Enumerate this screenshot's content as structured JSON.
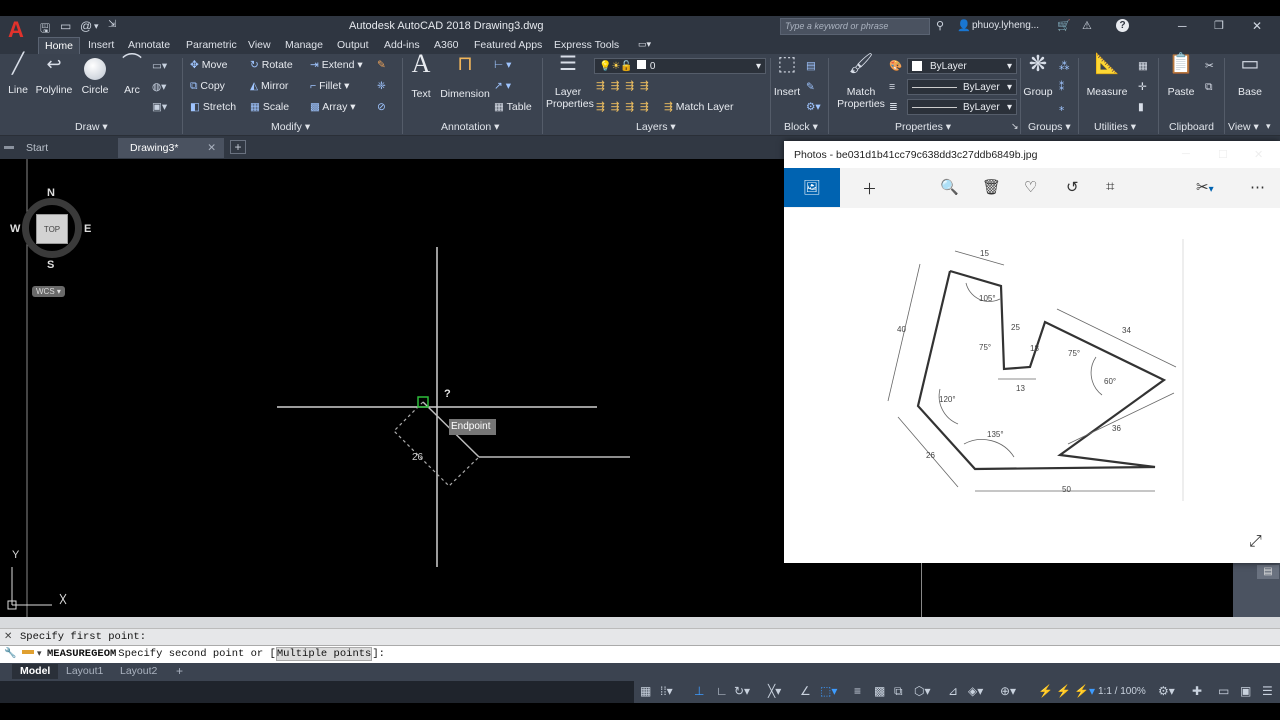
{
  "app": {
    "title": "Autodesk AutoCAD 2018    Drawing3.dwg",
    "logo": "A",
    "search_placeholder": "Type a keyword or phrase",
    "username": "phuoy.lyheng..."
  },
  "ribbon_tabs": [
    "Home",
    "Insert",
    "Annotate",
    "Parametric",
    "View",
    "Manage",
    "Output",
    "Add-ins",
    "A360",
    "Featured Apps",
    "Express Tools"
  ],
  "draw_panel": {
    "label": "Draw ▾",
    "line": "Line",
    "polyline": "Polyline",
    "circle": "Circle",
    "arc": "Arc"
  },
  "modify_panel": {
    "label": "Modify ▾",
    "move": "Move",
    "rotate": "Rotate",
    "extend": "Extend",
    "copy": "Copy",
    "mirror": "Mirror",
    "fillet": "Fillet",
    "stretch": "Stretch",
    "scale": "Scale",
    "array": "Array"
  },
  "annotation_panel": {
    "label": "Annotation ▾",
    "text": "Text",
    "dimension": "Dimension",
    "table": "Table"
  },
  "layers_panel": {
    "label": "Layers ▾",
    "layer_properties": "Layer\nProperties",
    "current_layer": "0",
    "match_layer": "Match Layer"
  },
  "block_panel": {
    "label": "Block ▾",
    "insert": "Insert"
  },
  "properties_panel": {
    "label": "Properties ▾",
    "match_properties": "Match\nProperties",
    "color": "ByLayer",
    "linetype": "ByLayer",
    "lineweight": "ByLayer"
  },
  "groups_panel": {
    "label": "Groups ▾",
    "group": "Group"
  },
  "utilities_panel": {
    "label": "Utilities ▾",
    "measure": "Measure"
  },
  "clipboard_panel": {
    "label": "Clipboard",
    "paste": "Paste"
  },
  "view_panel": {
    "label": "View ▾",
    "base": "Base"
  },
  "doc_tabs": [
    "Start",
    "Drawing3*"
  ],
  "viewcube": {
    "n": "N",
    "s": "S",
    "e": "E",
    "w": "W",
    "top": "TOP",
    "wcs": "WCS ▾"
  },
  "canvas": {
    "measure_value": "26",
    "cursor_mark": "?",
    "tooltip": "Endpoint",
    "ucs_y": "Y"
  },
  "photos": {
    "title": "Photos - be031d1b41cc79c638dd3c27ddb6849b.jpg",
    "dims": {
      "d15": "15",
      "d105": "105°",
      "d40": "40",
      "d25": "25",
      "d18": "18",
      "d75a": "75°",
      "d75b": "75°",
      "d34": "34",
      "d13": "13",
      "d60": "60°",
      "d120": "120°",
      "d135": "135°",
      "d36": "36",
      "d26": "26",
      "d50": "50"
    }
  },
  "command": {
    "line1": "Specify first point:",
    "cmd_name": "MEASUREGEOM",
    "line2_pre": " Specify second point or [",
    "line2_opt": "Multiple points",
    "line2_post": "]:"
  },
  "layout_tabs": [
    "Model",
    "Layout1",
    "Layout2"
  ],
  "status": {
    "scale": "1:1 / 100%"
  },
  "colors": {
    "accent": "#0063b1",
    "ribbon": "#3b4350",
    "canvas": "#000000",
    "endpoint_marker": "#2dbd3a"
  }
}
